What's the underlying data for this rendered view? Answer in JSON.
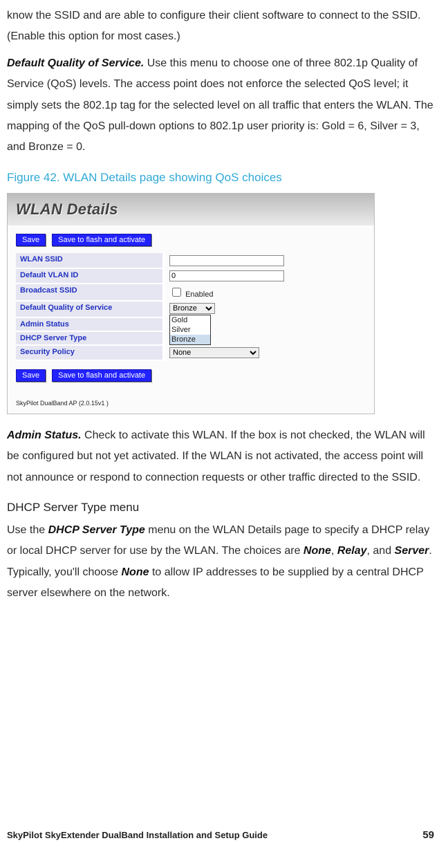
{
  "para_ssid_tail": "know the SSID and are able to configure their client software to connect to the SSID. (Enable this option for most cases.)",
  "qos_label": "Default Quality of Service.",
  "qos_text": " Use this menu to choose one of three 802.1p Quality of Service (QoS) levels. The access point does not enforce the selected QoS level; it simply sets the 802.1p tag for the selected level on all traffic that enters the WLAN. The mapping of the QoS pull-down options to 802.1p user priority is: Gold = 6, Silver = 3, and Bronze = 0.",
  "figure_caption": "Figure 42. WLAN Details page showing QoS choices",
  "wlan": {
    "title": "WLAN Details",
    "save": "Save",
    "save_flash": "Save to flash and activate",
    "rows": {
      "ssid": "WLAN SSID",
      "vlan": "Default VLAN ID",
      "vlan_val": "0",
      "broadcast": "Broadcast SSID",
      "enabled": "Enabled",
      "qos": "Default Quality of Service",
      "qos_selected": "Bronze",
      "admin": "Admin Status",
      "dhcp": "DHCP Server Type",
      "security": "Security Policy",
      "security_val": "None"
    },
    "qos_options": {
      "gold": "Gold",
      "silver": "Silver",
      "bronze": "Bronze"
    },
    "version": "SkyPilot DualBand AP (2.0.15v1 )"
  },
  "admin_label": "Admin Status.",
  "admin_text": " Check to activate this WLAN. If the box is not checked, the WLAN will be configured but not yet activated. If the WLAN is not activated, the access point will not announce or respond to connection requests or other traffic directed to the SSID.",
  "dhcp_heading": "DHCP Server Type menu",
  "dhcp_p1_a": "Use the ",
  "dhcp_p1_term": "DHCP Server Type",
  "dhcp_p1_b": " menu on the WLAN Details page to specify a DHCP relay or local DHCP server for use by the WLAN. The choices are ",
  "opt_none": "None",
  "sep_comma": ", ",
  "opt_relay": "Relay",
  "sep_and": ", and ",
  "opt_server": "Server",
  "dhcp_p1_c": ". Typically, you'll choose ",
  "dhcp_p1_d": " to allow IP addresses to be supplied by a central DHCP server elsewhere on the network.",
  "footer_title": "SkyPilot SkyExtender DualBand Installation and Setup Guide",
  "footer_page": "59"
}
